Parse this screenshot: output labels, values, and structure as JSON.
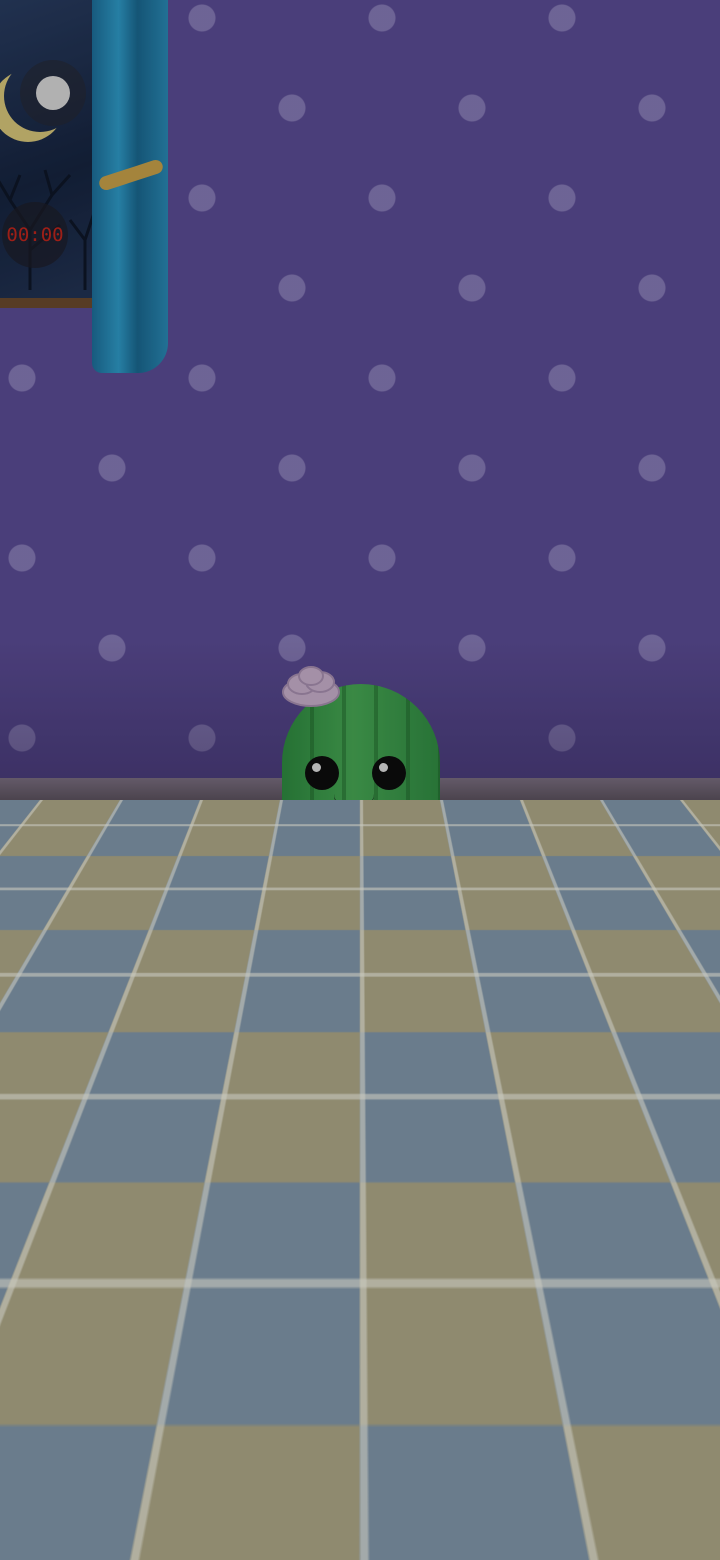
{
  "recorder": {
    "record_button_icon": "record-dot-icon",
    "timer_text": "00:00",
    "timer_color": "#c0261d"
  },
  "scene": {
    "wall_color": "#5b4c95",
    "pet": "cactus"
  },
  "music_button": {
    "icon": "music-note-icon",
    "color": "#1b7f92"
  },
  "nav": {
    "accent_color": "#5c45a8",
    "items": [
      {
        "icon": "sofa-icon"
      },
      {
        "icon": "food-bowl-icon"
      },
      {
        "icon": "gamepad-icon"
      },
      {
        "icon": "bathtub-icon"
      },
      {
        "icon": "bed-icon"
      }
    ]
  }
}
